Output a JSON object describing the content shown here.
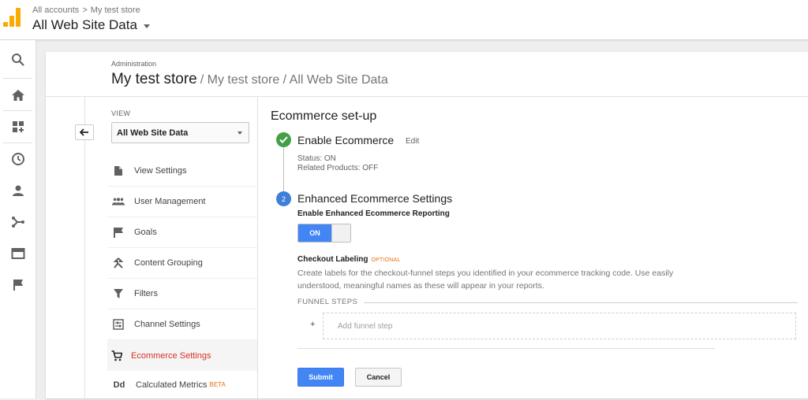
{
  "header": {
    "breadcrumb": [
      "All accounts",
      ">",
      "My test store"
    ],
    "view_title": "All Web Site Data",
    "logo_icon": "analytics-logo-icon",
    "logo_color": "#f9ab00"
  },
  "leftnav": {
    "items": [
      {
        "name": "search",
        "icon": "search-icon"
      },
      {
        "name": "home",
        "icon": "home-icon"
      },
      {
        "name": "customization",
        "icon": "dashboard-add-icon"
      },
      {
        "name": "realtime",
        "icon": "clock-icon"
      },
      {
        "name": "audience",
        "icon": "person-icon"
      },
      {
        "name": "acquisition",
        "icon": "acquisition-icon"
      },
      {
        "name": "behavior",
        "icon": "behavior-icon"
      },
      {
        "name": "conversions",
        "icon": "flag-icon"
      }
    ]
  },
  "page": {
    "admin_label": "Administration",
    "title": "My test store",
    "title_sub": "/ My test store / All Web Site Data"
  },
  "view_column": {
    "label": "VIEW",
    "selected": "All Web Site Data",
    "menu": [
      {
        "label": "View Settings",
        "icon": "document-icon"
      },
      {
        "label": "User Management",
        "icon": "group-icon"
      },
      {
        "label": "Goals",
        "icon": "flag-icon"
      },
      {
        "label": "Content Grouping",
        "icon": "content-grouping-icon"
      },
      {
        "label": "Filters",
        "icon": "filter-icon"
      },
      {
        "label": "Channel Settings",
        "icon": "channel-settings-icon"
      },
      {
        "label": "Ecommerce Settings",
        "icon": "cart-icon",
        "active": true
      },
      {
        "label": "Calculated Metrics",
        "icon": "calculated-metrics-icon",
        "badge": "BETA"
      }
    ]
  },
  "ecommerce": {
    "title": "Ecommerce set-up",
    "step1": {
      "title": "Enable Ecommerce",
      "edit": "Edit",
      "status": "Status: ON",
      "related": "Related Products: OFF"
    },
    "step2": {
      "number": "2",
      "title": "Enhanced Ecommerce Settings",
      "reporting_label": "Enable Enhanced Ecommerce Reporting",
      "toggle": "ON"
    },
    "checkout": {
      "title": "Checkout Labeling",
      "optional": "OPTIONAL",
      "description": "Create labels for the checkout-funnel steps you identified in your ecommerce tracking code. Use easily understood, meaningful names as these will appear in your reports.",
      "funnel_label": "FUNNEL STEPS",
      "plus": "+",
      "add_step": "Add funnel step"
    },
    "submit": "Submit",
    "cancel": "Cancel",
    "colors": {
      "accent": "#4285f4",
      "active_text": "#d93025",
      "success": "#43a047",
      "step": "#3f7fd8",
      "optional": "#e8710a"
    }
  }
}
